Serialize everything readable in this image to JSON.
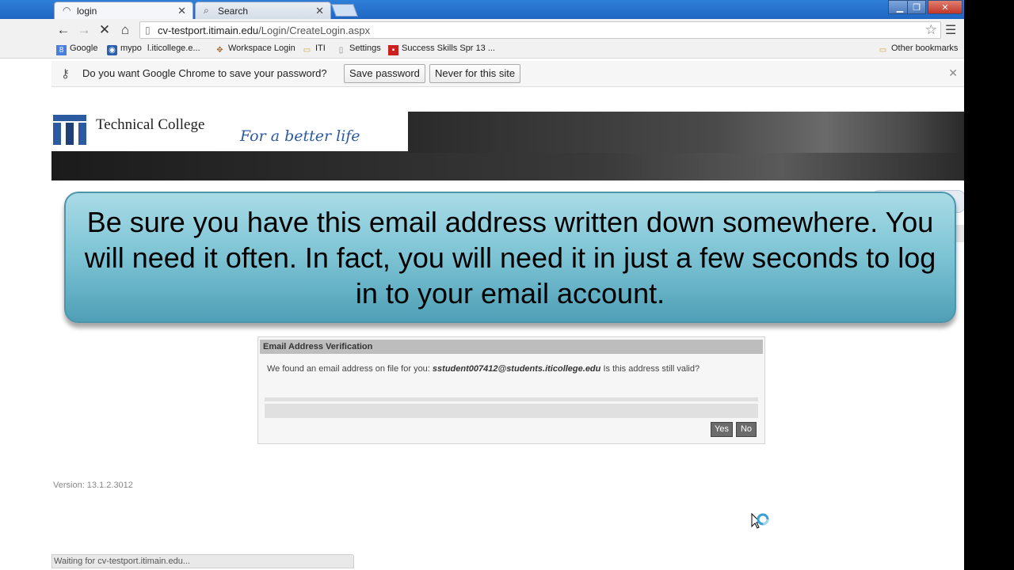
{
  "browser": {
    "tabs": [
      {
        "label": "login",
        "icon": "loading-spinner-icon",
        "active": true
      },
      {
        "label": "Search",
        "icon": "search-icon",
        "active": false
      }
    ],
    "url_host": "cv-testport.itimain.edu",
    "url_path": "/Login/CreateLogin.aspx",
    "bookmarks": [
      {
        "label": "Google",
        "icon": "google-icon"
      },
      {
        "label": "mypo",
        "icon": "mypo-icon"
      },
      {
        "label": "l.iticollege.e...",
        "icon": "page-icon"
      },
      {
        "label": "Workspace Login",
        "icon": "workspace-icon"
      },
      {
        "label": "ITI",
        "icon": "folder-icon"
      },
      {
        "label": "Settings",
        "icon": "page-icon"
      },
      {
        "label": "Success Skills Spr 13 ...",
        "icon": "bookmark-red-icon"
      }
    ],
    "other_bookmarks": "Other bookmarks",
    "infobar": {
      "message": "Do you want Google Chrome to save your password?",
      "save_label": "Save password",
      "never_label": "Never for this site"
    },
    "status": "Waiting for cv-testport.itimain.edu..."
  },
  "site": {
    "name": "Technical College",
    "tagline": "For a better life"
  },
  "callout": {
    "text": "Be sure you have this email address written down somewhere. You will need it often. In fact, you will need it in just a few seconds to log in to your email account."
  },
  "dialog": {
    "title": "Email Address Verification",
    "prefix": "We found an email address on file for you:",
    "email": "sstudent007412@students.iticollege.edu",
    "suffix": "Is this address still valid?",
    "yes_label": "Yes",
    "no_label": "No"
  },
  "version": "Version: 13.1.2.3012",
  "colors": {
    "chrome_blue": "#1f66c2",
    "callout_teal": "#7cc3d4",
    "brand_blue": "#2c5aa0",
    "dialog_button": "#6b6b6b"
  }
}
